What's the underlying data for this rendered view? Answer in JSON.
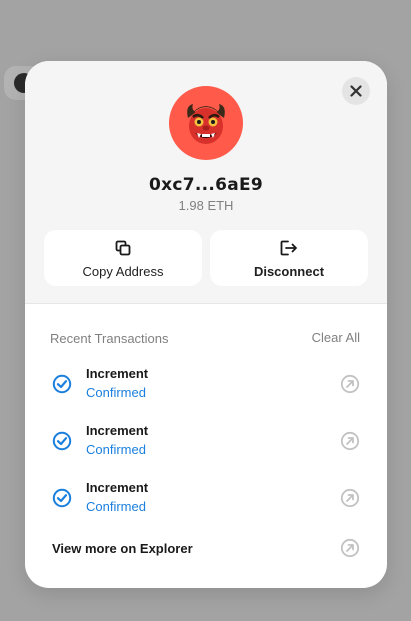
{
  "account": {
    "address": "0xc7...6aE9",
    "balance": "1.98 ETH",
    "avatar_icon": "red-oni-mask-icon",
    "avatar_color": "#ff5a4a"
  },
  "actions": {
    "copy_label": "Copy Address",
    "disconnect_label": "Disconnect"
  },
  "transactions": {
    "title": "Recent Transactions",
    "clear_label": "Clear All",
    "items": [
      {
        "title": "Increment",
        "status": "Confirmed"
      },
      {
        "title": "Increment",
        "status": "Confirmed"
      },
      {
        "title": "Increment",
        "status": "Confirmed"
      }
    ],
    "status_color": "#1a7fdd"
  },
  "explorer": {
    "label": "View more on Explorer"
  }
}
